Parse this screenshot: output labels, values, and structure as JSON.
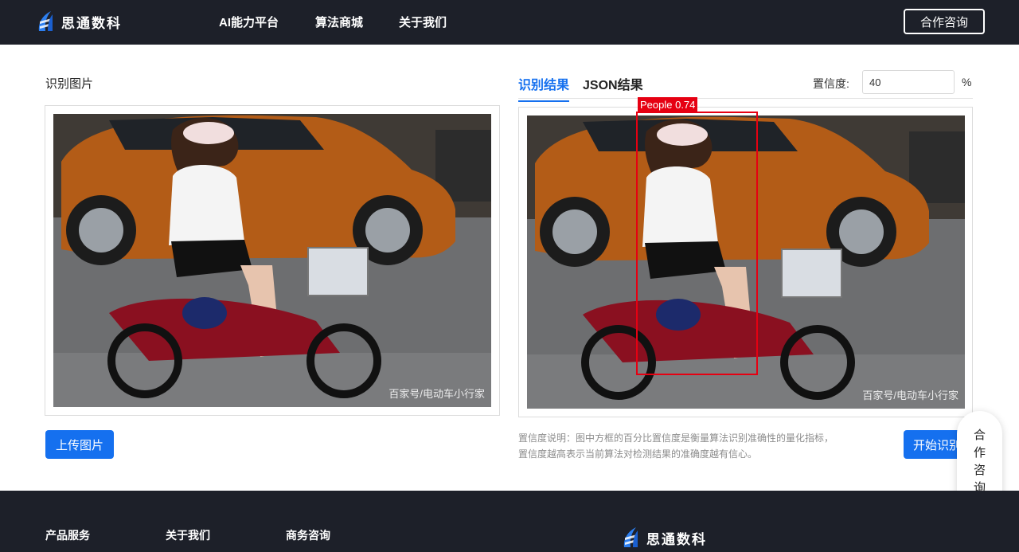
{
  "header": {
    "brand": "思通数科",
    "nav": [
      "AI能力平台",
      "算法商城",
      "关于我们"
    ],
    "consult_button": "合作咨询"
  },
  "left_panel": {
    "title": "识别图片",
    "watermark": "百家号/电动车小行家",
    "upload_button": "上传图片"
  },
  "right_panel": {
    "tabs": [
      "识别结果",
      "JSON结果"
    ],
    "active_tab": "识别结果",
    "confidence_label": "置信度:",
    "confidence_value": "40",
    "confidence_unit": "%",
    "watermark": "百家号/电动车小行家",
    "detection": {
      "label": "People 0.74",
      "class": "People",
      "score": 0.74,
      "color": "#e60012"
    },
    "note_line1": "置信度说明：图中方框的百分比置信度是衡量算法识别准确性的量化指标，",
    "note_line2": "置信度越高表示当前算法对检测结果的准确度越有信心。",
    "start_button": "开始识别"
  },
  "float_consult": {
    "chars": [
      "合",
      "作",
      "咨",
      "询"
    ],
    "icon": "chat-icon"
  },
  "footer": {
    "columns": [
      "产品服务",
      "关于我们",
      "商务咨询"
    ],
    "brand": "思通数科"
  },
  "colors": {
    "primary": "#1570ef",
    "header_bg": "#1d2029",
    "box": "#e60012"
  }
}
